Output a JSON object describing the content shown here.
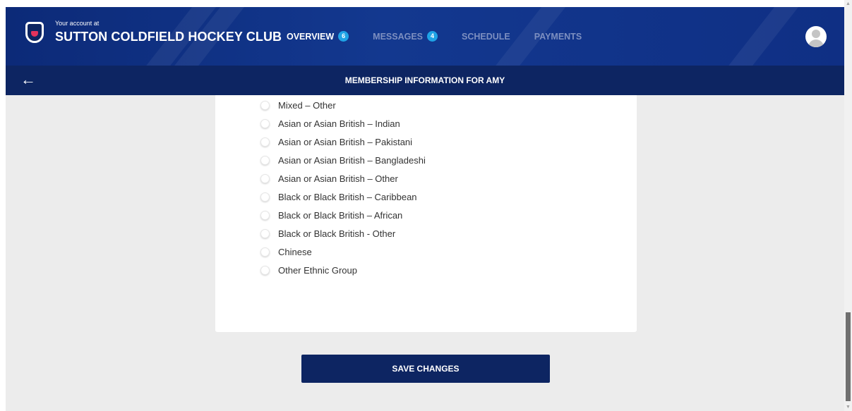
{
  "header": {
    "subtitle": "Your account at",
    "club_name": "SUTTON COLDFIELD HOCKEY CLUB",
    "nav": [
      {
        "label": "OVERVIEW",
        "badge": "6",
        "active": true
      },
      {
        "label": "MESSAGES",
        "badge": "4",
        "active": false
      },
      {
        "label": "SCHEDULE",
        "badge": null,
        "active": false
      },
      {
        "label": "PAYMENTS",
        "badge": null,
        "active": false
      }
    ]
  },
  "subheader": {
    "back_icon": "←",
    "title": "MEMBERSHIP INFORMATION FOR AMY"
  },
  "ethnicity_options": [
    "Mixed – Other",
    "Asian or Asian British – Indian",
    "Asian or Asian British – Pakistani",
    "Asian or Asian British – Bangladeshi",
    "Asian or Asian British – Other",
    "Black or Black British – Caribbean",
    "Black or Black British – African",
    "Black or Black British - Other",
    "Chinese",
    "Other Ethnic Group"
  ],
  "actions": {
    "save_label": "SAVE CHANGES"
  },
  "colors": {
    "header_bg": "#0f2f84",
    "subbar_bg": "#0d2562",
    "badge": "#1fa3e6",
    "page_bg": "#ececec",
    "accent_red": "#e4335c"
  }
}
